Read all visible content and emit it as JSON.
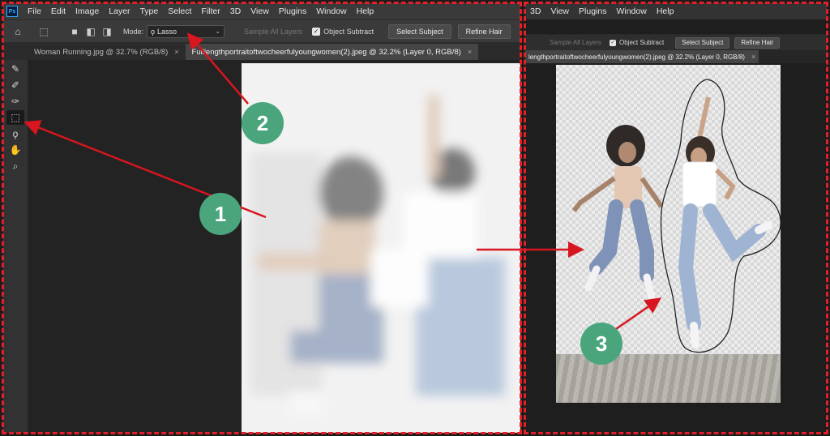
{
  "menu": [
    "File",
    "Edit",
    "Image",
    "Layer",
    "Type",
    "Select",
    "Filter",
    "3D",
    "View",
    "Plugins",
    "Window",
    "Help"
  ],
  "menu_right": [
    "3D",
    "View",
    "Plugins",
    "Window",
    "Help"
  ],
  "options": {
    "mode_label": "Mode:",
    "mode_value": "Lasso",
    "sample_all_layers": "Sample All Layers",
    "object_subtract": "Object Subtract",
    "select_subject": "Select Subject",
    "refine_hair": "Refine Hair"
  },
  "tabs": [
    {
      "label": "Woman Running.jpg @ 32.7% (RGB/8)",
      "close": "×"
    },
    {
      "label": "Fulllengthportraitoftwocheerfulyoungwomen(2).jpeg @ 32.2% (Layer 0, RGB/8)",
      "close": "×"
    }
  ],
  "right_tab": "lengthportraitoftwocheerfulyoungwomen(2).jpeg @ 32.2% (Layer 0, RGB/8)",
  "annotations": [
    "1",
    "2",
    "3"
  ],
  "accent_colors": {
    "dash": "#e3202a",
    "badge": "#4aa57d",
    "arrow": "#d7161f"
  },
  "tools": [
    "brush-icon",
    "brush-plus-icon",
    "brush-minus-icon",
    "object-selection-icon",
    "lasso-icon",
    "hand-icon",
    "zoom-icon"
  ]
}
